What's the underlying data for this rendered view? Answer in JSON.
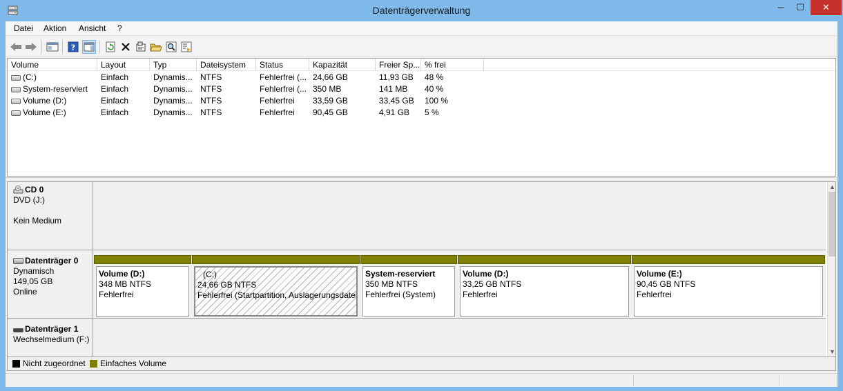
{
  "window": {
    "title": "Datenträgerverwaltung",
    "close_glyph": "✕",
    "minimize_glyph": "─",
    "maximize_glyph": "☐"
  },
  "menu": [
    "Datei",
    "Aktion",
    "Ansicht",
    "?"
  ],
  "toolbar": {
    "icons": [
      "back-arrow-icon",
      "forward-arrow-icon",
      "show-hide-console-tree-icon",
      "help-icon",
      "show-hide-action-pane-icon",
      "refresh-icon",
      "delete-icon",
      "properties-icon",
      "open-folder-icon",
      "search-icon",
      "export-list-icon"
    ]
  },
  "volume_table": {
    "columns": [
      "Volume",
      "Layout",
      "Typ",
      "Dateisystem",
      "Status",
      "Kapazität",
      "Freier Sp...",
      "% frei"
    ],
    "rows": [
      [
        "(C:)",
        "Einfach",
        "Dynamis...",
        "NTFS",
        "Fehlerfrei (...",
        "24,66 GB",
        "11,93 GB",
        "48 %"
      ],
      [
        "System-reserviert",
        "Einfach",
        "Dynamis...",
        "NTFS",
        "Fehlerfrei (...",
        "350 MB",
        "141 MB",
        "40 %"
      ],
      [
        "Volume (D:)",
        "Einfach",
        "Dynamis...",
        "NTFS",
        "Fehlerfrei",
        "33,59 GB",
        "33,45 GB",
        "100 %"
      ],
      [
        "Volume (E:)",
        "Einfach",
        "Dynamis...",
        "NTFS",
        "Fehlerfrei",
        "90,45 GB",
        "4,91 GB",
        "5 %"
      ]
    ]
  },
  "disks": [
    {
      "name": "CD 0",
      "line1": "DVD (J:)",
      "line2": "",
      "line3": "Kein Medium"
    },
    {
      "name": "Datenträger 0",
      "line1": "Dynamisch",
      "line2": "149,05 GB",
      "line3": "Online",
      "partitions": [
        {
          "name": "Volume  (D:)",
          "size": "348 MB NTFS",
          "status": "Fehlerfrei"
        },
        {
          "name": "(C:)",
          "size": "24,66 GB NTFS",
          "status": "Fehlerfrei (Startpartition, Auslagerungsdatei, "
        },
        {
          "name": "System-reserviert",
          "size": "350 MB NTFS",
          "status": "Fehlerfrei (System)"
        },
        {
          "name": "Volume  (D:)",
          "size": "33,25 GB NTFS",
          "status": "Fehlerfrei"
        },
        {
          "name": "Volume  (E:)",
          "size": "90,45 GB NTFS",
          "status": "Fehlerfrei"
        }
      ]
    },
    {
      "name": "Datenträger 1",
      "line1": "Wechselmedium (F:)"
    }
  ],
  "legend": {
    "unallocated": "Nicht zugeordnet",
    "simple_volume": "Einfaches Volume",
    "unallocated_color": "#000000",
    "simple_volume_color": "#808000"
  },
  "colors": {
    "titlebar": "#7eb9ea",
    "close_button": "#c7312b",
    "partition_bar": "#808000"
  }
}
